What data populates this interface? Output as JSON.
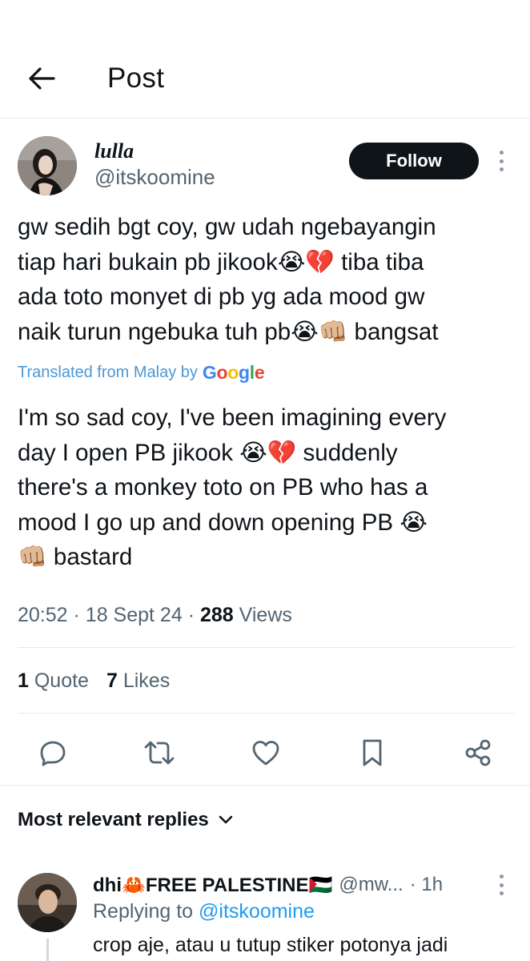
{
  "header": {
    "title": "Post",
    "back_icon": "arrow-left-icon"
  },
  "post": {
    "author": {
      "display_name": "lulla",
      "handle": "@itskoomine"
    },
    "follow_label": "Follow",
    "text": "gw sedih bgt coy, gw udah ngebayangin\ntiap hari bukain pb jikook😭💔 tiba tiba\nada toto monyet di pb yg ada mood gw\nnaik turun ngebuka tuh pb😭👊🏼 bangsat",
    "translated_label": "Translated from Malay by",
    "translated_brand": "Google",
    "translation": "I'm so sad coy, I've been imagining every\nday I open PB jikook 😭💔 suddenly\nthere's a monkey toto on PB who has a\nmood I go up and down opening PB 😭\n👊🏼 bastard",
    "time": "20:52",
    "date": "18 Sept 24",
    "views_count": "288",
    "views_label": "Views",
    "quotes_count": "1",
    "quotes_label": "Quote",
    "likes_count": "7",
    "likes_label": "Likes"
  },
  "actions": [
    "reply-icon",
    "repost-icon",
    "like-icon",
    "bookmark-icon",
    "share-icon"
  ],
  "replies_sort": {
    "label": "Most relevant replies",
    "icon": "chevron-down-icon"
  },
  "reply": {
    "name": "dhi🦀FREE PALESTINE🇵🇸",
    "handle": "@mw...",
    "time": "· 1h",
    "replying_prefix": "Replying to",
    "replying_to": "@itskoomine",
    "text": "crop aje, atau u tutup stiker potonya jadi"
  },
  "colors": {
    "accent": "#1d9bf0",
    "translated": "#4b98d6",
    "text": "#0f1419",
    "muted": "#536471",
    "divider": "#e6e9eb"
  }
}
